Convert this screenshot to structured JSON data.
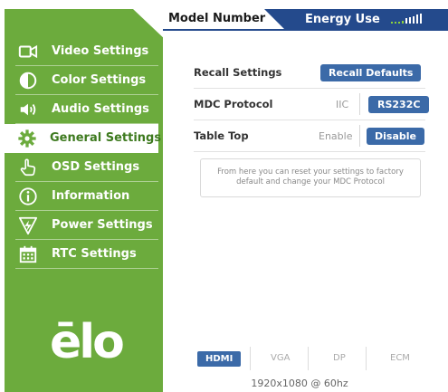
{
  "header": {
    "model_number_label": "Model Number",
    "energy_use_label": "Energy Use",
    "energy_level_bars_on": 5,
    "energy_level_bars_total": 9
  },
  "sidebar": {
    "items": [
      {
        "label": "Video Settings",
        "icon": "video-camera-icon"
      },
      {
        "label": "Color Settings",
        "icon": "contrast-icon"
      },
      {
        "label": "Audio Settings",
        "icon": "speaker-icon"
      },
      {
        "label": "General Settings",
        "icon": "gear-icon",
        "active": true
      },
      {
        "label": "OSD Settings",
        "icon": "hand-pointer-icon"
      },
      {
        "label": "Information",
        "icon": "info-icon"
      },
      {
        "label": "Power Settings",
        "icon": "power-bolt-icon"
      },
      {
        "label": "RTC Settings",
        "icon": "calendar-icon"
      }
    ],
    "logo_text": "ēlo"
  },
  "settings": {
    "recall": {
      "label": "Recall Settings",
      "button": "Recall Defaults"
    },
    "mdc": {
      "label": "MDC Protocol",
      "option_1": "IIC",
      "option_2": "RS232C",
      "selected": "RS232C"
    },
    "table_top": {
      "label": "Table Top",
      "option_1": "Enable",
      "option_2": "Disable",
      "selected": "Disable"
    },
    "info_text": "From here you can reset your settings to factory default and change your MDC Protocol"
  },
  "inputs": {
    "options": [
      "HDMI",
      "VGA",
      "DP",
      "ECM"
    ],
    "selected": "HDMI",
    "resolution": "1920x1080 @ 60hz"
  },
  "colors": {
    "sidebar_green": "#6cab3d",
    "header_blue": "#244a8c",
    "button_blue": "#3b6aa8",
    "energy_green": "#8dd43a"
  }
}
